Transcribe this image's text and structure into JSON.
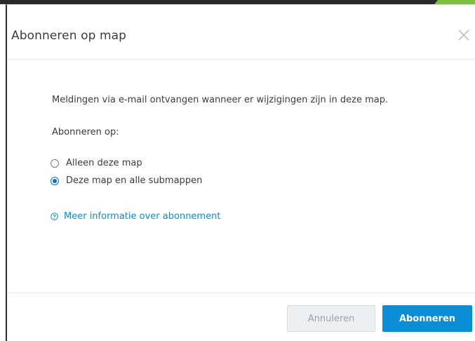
{
  "dialog": {
    "title": "Abonneren op map",
    "close_icon": "close-icon",
    "description": "Meldingen via e-mail ontvangen wanneer er wijzigingen zijn in deze map.",
    "section_label": "Abonneren op:",
    "options": [
      {
        "label": "Alleen deze map",
        "checked": false
      },
      {
        "label": "Deze map en alle submappen",
        "checked": true
      }
    ],
    "info_link": {
      "icon": "help-circle-icon",
      "label": "Meer informatie over abonnement"
    },
    "buttons": {
      "cancel": "Annuleren",
      "subscribe": "Abonneren"
    }
  },
  "colors": {
    "accent": "#0b8dd6",
    "text": "#3c3c3c",
    "cancel_bg": "#edf0f3",
    "cancel_text": "#9aa1a8",
    "backdrop_green": "#7cc242"
  }
}
